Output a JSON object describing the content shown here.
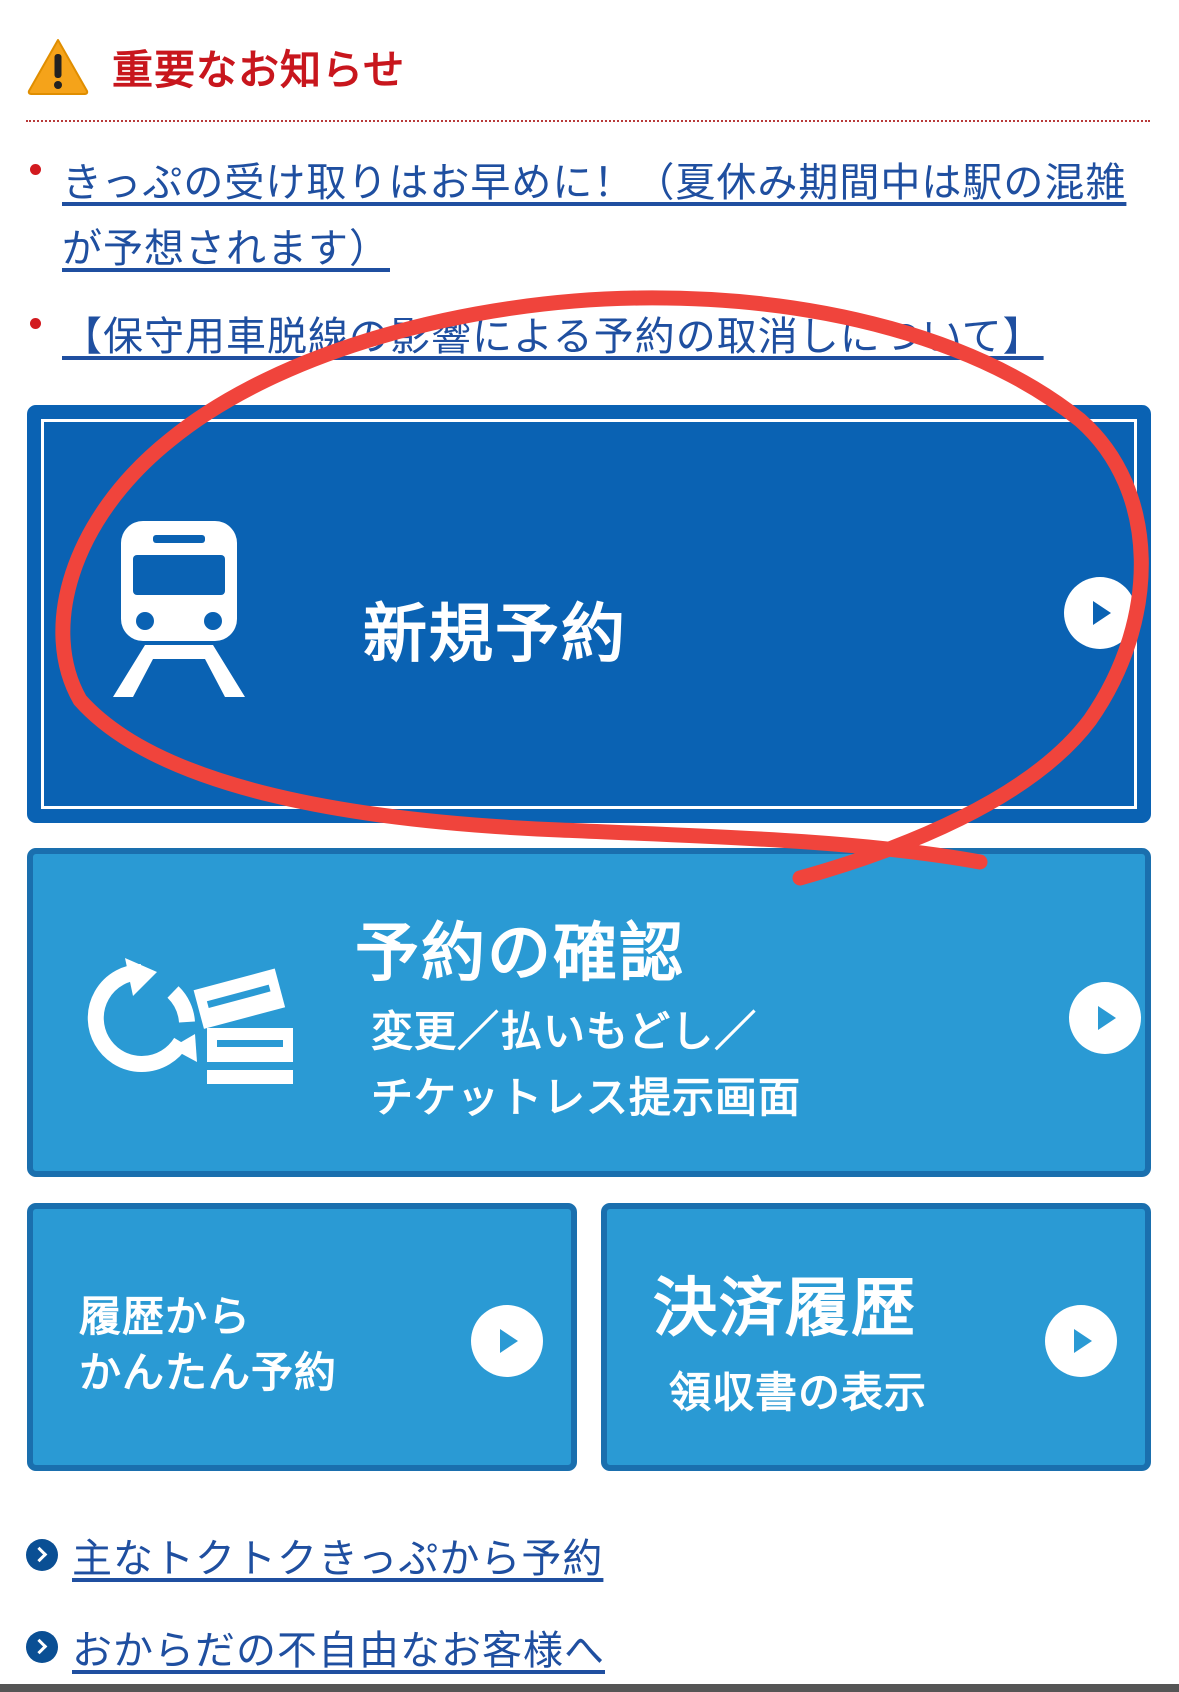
{
  "notice": {
    "title": "重要なお知らせ",
    "items": [
      "きっぷの受け取りはお早めに！（夏休み期間中は駅の混雑が予想されます）",
      "【保守用車脱線の影響による予約の取消しについて】"
    ]
  },
  "buttons": {
    "new_reservation": {
      "label": "新規予約",
      "icon": "train-icon"
    },
    "confirm": {
      "title": "予約の確認",
      "sub1": "変更／払いもどし／",
      "sub2": "チケットレス提示画面",
      "icon": "refresh-tickets-icon"
    },
    "history": {
      "line1": "履歴から",
      "line2": "かんたん予約"
    },
    "payment": {
      "title": "決済履歴",
      "sub": "領収書の表示"
    }
  },
  "footer_links": [
    "主なトクトクきっぷから予約",
    "おからだの不自由なお客様へ"
  ],
  "colors": {
    "primary": "#0a62b3",
    "secondary": "#2a9ad4",
    "alert": "#c8161d",
    "link": "#1f4fa0",
    "annotation": "#f0443c"
  }
}
